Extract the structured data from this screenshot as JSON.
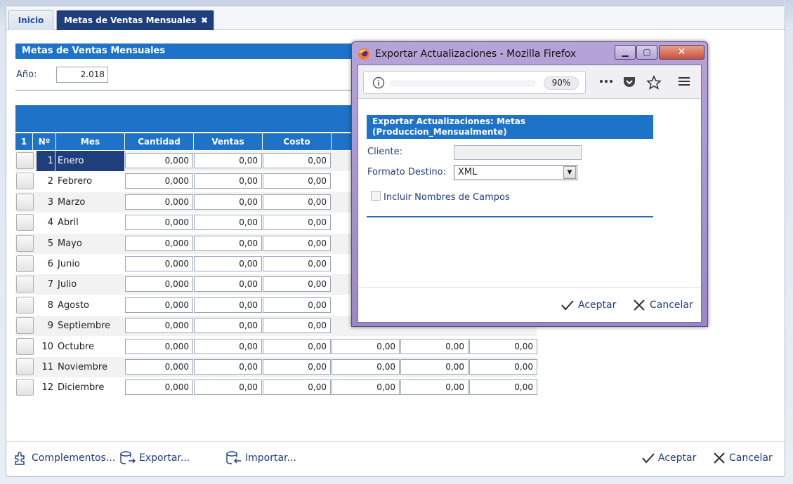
{
  "tabs": [
    {
      "label": "Inicio"
    },
    {
      "label": "Metas de Ventas Mensuales",
      "close": "✖"
    }
  ],
  "form": {
    "title": "Metas de Ventas Mensuales",
    "ano_label": "Año:",
    "ano_value": "2.018"
  },
  "grid": {
    "headers": [
      "1",
      "Nº",
      "Mes",
      "Cantidad",
      "Ventas",
      "Costo"
    ],
    "rows": [
      {
        "n": "1",
        "mes": "Enero",
        "cantidad": "0,000",
        "ventas": "0,00",
        "costo": "0,00",
        "c4": "",
        "c5": "",
        "c6": ""
      },
      {
        "n": "2",
        "mes": "Febrero",
        "cantidad": "0,000",
        "ventas": "0,00",
        "costo": "0,00",
        "c4": "",
        "c5": "",
        "c6": ""
      },
      {
        "n": "3",
        "mes": "Marzo",
        "cantidad": "0,000",
        "ventas": "0,00",
        "costo": "0,00",
        "c4": "",
        "c5": "",
        "c6": ""
      },
      {
        "n": "4",
        "mes": "Abril",
        "cantidad": "0,000",
        "ventas": "0,00",
        "costo": "0,00",
        "c4": "",
        "c5": "",
        "c6": ""
      },
      {
        "n": "5",
        "mes": "Mayo",
        "cantidad": "0,000",
        "ventas": "0,00",
        "costo": "0,00",
        "c4": "",
        "c5": "",
        "c6": ""
      },
      {
        "n": "6",
        "mes": "Junio",
        "cantidad": "0,000",
        "ventas": "0,00",
        "costo": "0,00",
        "c4": "",
        "c5": "",
        "c6": ""
      },
      {
        "n": "7",
        "mes": "Julio",
        "cantidad": "0,000",
        "ventas": "0,00",
        "costo": "0,00",
        "c4": "",
        "c5": "",
        "c6": ""
      },
      {
        "n": "8",
        "mes": "Agosto",
        "cantidad": "0,000",
        "ventas": "0,00",
        "costo": "0,00",
        "c4": "",
        "c5": "",
        "c6": ""
      },
      {
        "n": "9",
        "mes": "Septiembre",
        "cantidad": "0,000",
        "ventas": "0,00",
        "costo": "0,00",
        "c4": "",
        "c5": "",
        "c6": ""
      },
      {
        "n": "10",
        "mes": "Octubre",
        "cantidad": "0,000",
        "ventas": "0,00",
        "costo": "0,00",
        "c4": "0,00",
        "c5": "0,00",
        "c6": "0,00"
      },
      {
        "n": "11",
        "mes": "Noviembre",
        "cantidad": "0,000",
        "ventas": "0,00",
        "costo": "0,00",
        "c4": "0,00",
        "c5": "0,00",
        "c6": "0,00"
      },
      {
        "n": "12",
        "mes": "Diciembre",
        "cantidad": "0,000",
        "ventas": "0,00",
        "costo": "0,00",
        "c4": "0,00",
        "c5": "0,00",
        "c6": "0,00"
      }
    ]
  },
  "footer": {
    "complementos": "Complementos...",
    "exportar": "Exportar...",
    "importar": "Importar...",
    "aceptar": "Aceptar",
    "cancelar": "Cancelar"
  },
  "popup": {
    "window_title": "Exportar Actualizaciones - Mozilla Firefox",
    "zoom": "90%",
    "section_title_line1": "Exportar Actualizaciones: Metas",
    "section_title_line2": "(Produccion_Mensualmente)",
    "cliente_label": "Cliente:",
    "cliente_value": "",
    "formato_label": "Formato Destino:",
    "formato_value": "XML",
    "incluir_label": "Incluir Nombres de Campos",
    "incluir_checked": false,
    "aceptar": "Aceptar",
    "cancelar": "Cancelar"
  },
  "colors": {
    "accent": "#1e73c8",
    "dark_blue": "#1f3e7c",
    "popup_chrome": "#a894d0"
  }
}
